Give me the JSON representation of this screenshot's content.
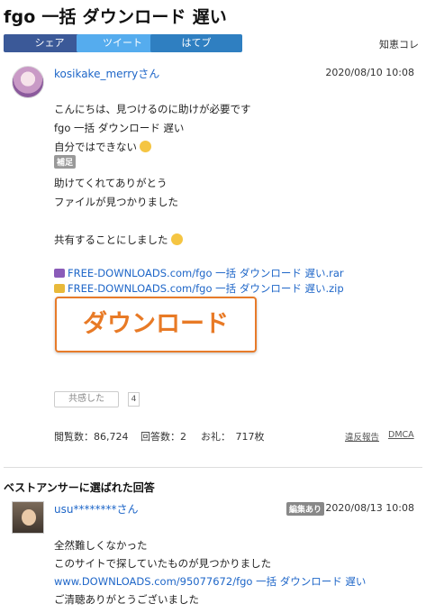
{
  "page": {
    "title": "fgo 一括 ダウンロード 遅い"
  },
  "share": {
    "share": "シェア",
    "tweet": "ツイート",
    "hatebu": "はてブ",
    "chie": "知恵コレ"
  },
  "colors": {
    "share": "#3b5998",
    "tweet": "#55acee",
    "hatebu": "#2f7fc1",
    "link": "#1e66c8",
    "download": "#e87a26"
  },
  "question": {
    "user": "kosikake_merryさん",
    "date": "2020/08/10 10:08",
    "lines": [
      "こんにちは、見つけるのに助けが必要です",
      "fgo 一括 ダウンロード 遅い",
      "自分ではできない"
    ],
    "tag": "補足",
    "supplement": [
      "助けてくれてありがとう",
      "ファイルが見つかりました",
      "共有することにしました"
    ],
    "files": [
      "FREE-DOWNLOADS.com/fgo 一括 ダウンロード 遅い.rar",
      "FREE-DOWNLOADS.com/fgo 一括 ダウンロード 遅い.zip"
    ],
    "download_label": "ダウンロード",
    "kyokan": "共感した",
    "kyokan_count": "4",
    "views": "閲覧数：86,724",
    "answers": "回答数：2",
    "reward": "お礼：　717枚",
    "report": "違反報告",
    "dmca": "DMCA"
  },
  "best": {
    "heading": "ベストアンサーに選ばれた回答",
    "user": "usu********さん",
    "edited": "編集あり",
    "date": "2020/08/13 10:08",
    "lines": [
      "全然難しくなかった",
      "このサイトで探していたものが見つかりました"
    ],
    "link": "www.DOWNLOADS.com/95077672/fgo 一括 ダウンロード 遅い",
    "closing": "ご清聴ありがとうございました"
  }
}
